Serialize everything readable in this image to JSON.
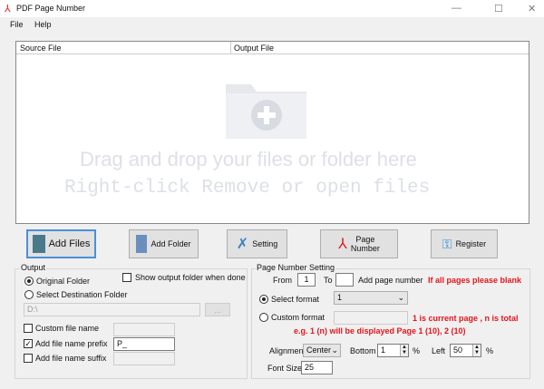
{
  "window": {
    "title": "PDF Page Number"
  },
  "menu": [
    "File",
    "Help"
  ],
  "list": {
    "columns": [
      "Source File",
      "Output File"
    ],
    "hint1": "Drag and drop your files or folder here",
    "hint2": "Right-click Remove or open files"
  },
  "toolbar": {
    "add_files": "Add Files",
    "add_folder": "Add Folder",
    "setting": "Setting",
    "page_number": "Page\nNumber",
    "page": "Page",
    "number": "Number",
    "register": "Register"
  },
  "output": {
    "title": "Output",
    "original_folder": "Original Folder",
    "select_dest": "Select Destination Folder",
    "show_output": "Show output folder when done",
    "dest_path": "D:\\",
    "browse": "...",
    "custom_name": "Custom file name",
    "add_prefix": "Add file name prefix",
    "prefix_value": "P_",
    "add_suffix": "Add file name suffix"
  },
  "page": {
    "title": "Page Number Setting",
    "from": "From",
    "from_value": "1",
    "to": "To",
    "to_value": "",
    "add_page_number": "Add page number",
    "blank_note": "If all pages please blank",
    "select_format": "Select format",
    "format_value": "1",
    "custom_format": "Custom format",
    "custom_note": "1 is current page , n is total",
    "example": "e.g.  1 (n) will be displayed Page 1 (10), 2 (10)",
    "alignment": "Alignmen",
    "alignment_value": "Center",
    "bottom": "Bottom",
    "bottom_value": "1",
    "left": "Left",
    "left_value": "50",
    "percent": "%",
    "font_size": "Font Size",
    "font_size_value": "25"
  }
}
